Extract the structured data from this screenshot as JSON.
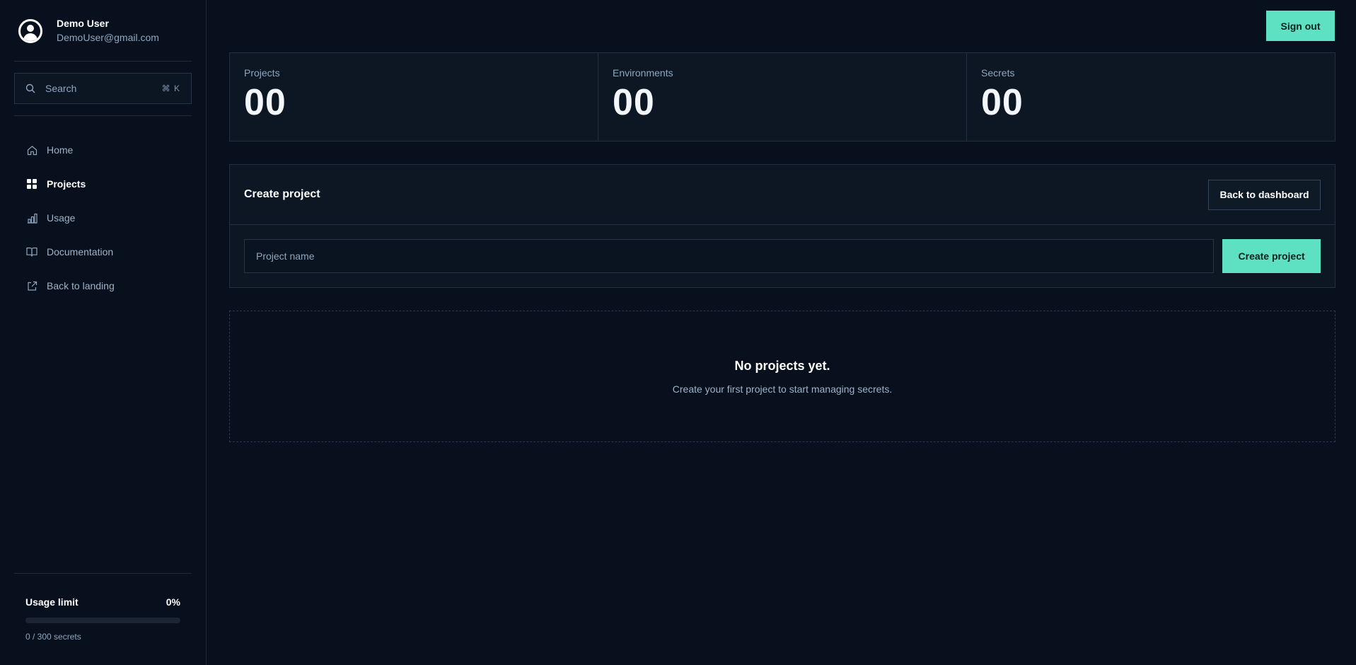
{
  "user": {
    "name": "Demo User",
    "email": "DemoUser@gmail.com"
  },
  "search": {
    "label": "Search",
    "shortcut": "⌘ K"
  },
  "sidebar": {
    "items": [
      {
        "label": "Home",
        "icon": "home-icon"
      },
      {
        "label": "Projects",
        "icon": "grid-icon",
        "active": true
      },
      {
        "label": "Usage",
        "icon": "bar-chart-icon"
      },
      {
        "label": "Documentation",
        "icon": "book-icon"
      },
      {
        "label": "Back to landing",
        "icon": "external-link-icon"
      }
    ]
  },
  "usage": {
    "title": "Usage limit",
    "percent_label": "0%",
    "fraction": 0,
    "detail": "0 / 300 secrets"
  },
  "header": {
    "signout_label": "Sign out"
  },
  "stats": [
    {
      "label": "Projects",
      "value": "00"
    },
    {
      "label": "Environments",
      "value": "00"
    },
    {
      "label": "Secrets",
      "value": "00"
    }
  ],
  "create": {
    "title": "Create project",
    "back_label": "Back to dashboard",
    "input_placeholder": "Project name",
    "input_value": "",
    "submit_label": "Create project"
  },
  "empty": {
    "title": "No projects yet.",
    "subtitle": "Create your first project to start managing secrets."
  },
  "colors": {
    "accent": "#5ee0c2",
    "background": "#07101c",
    "panel": "#0d1724"
  }
}
